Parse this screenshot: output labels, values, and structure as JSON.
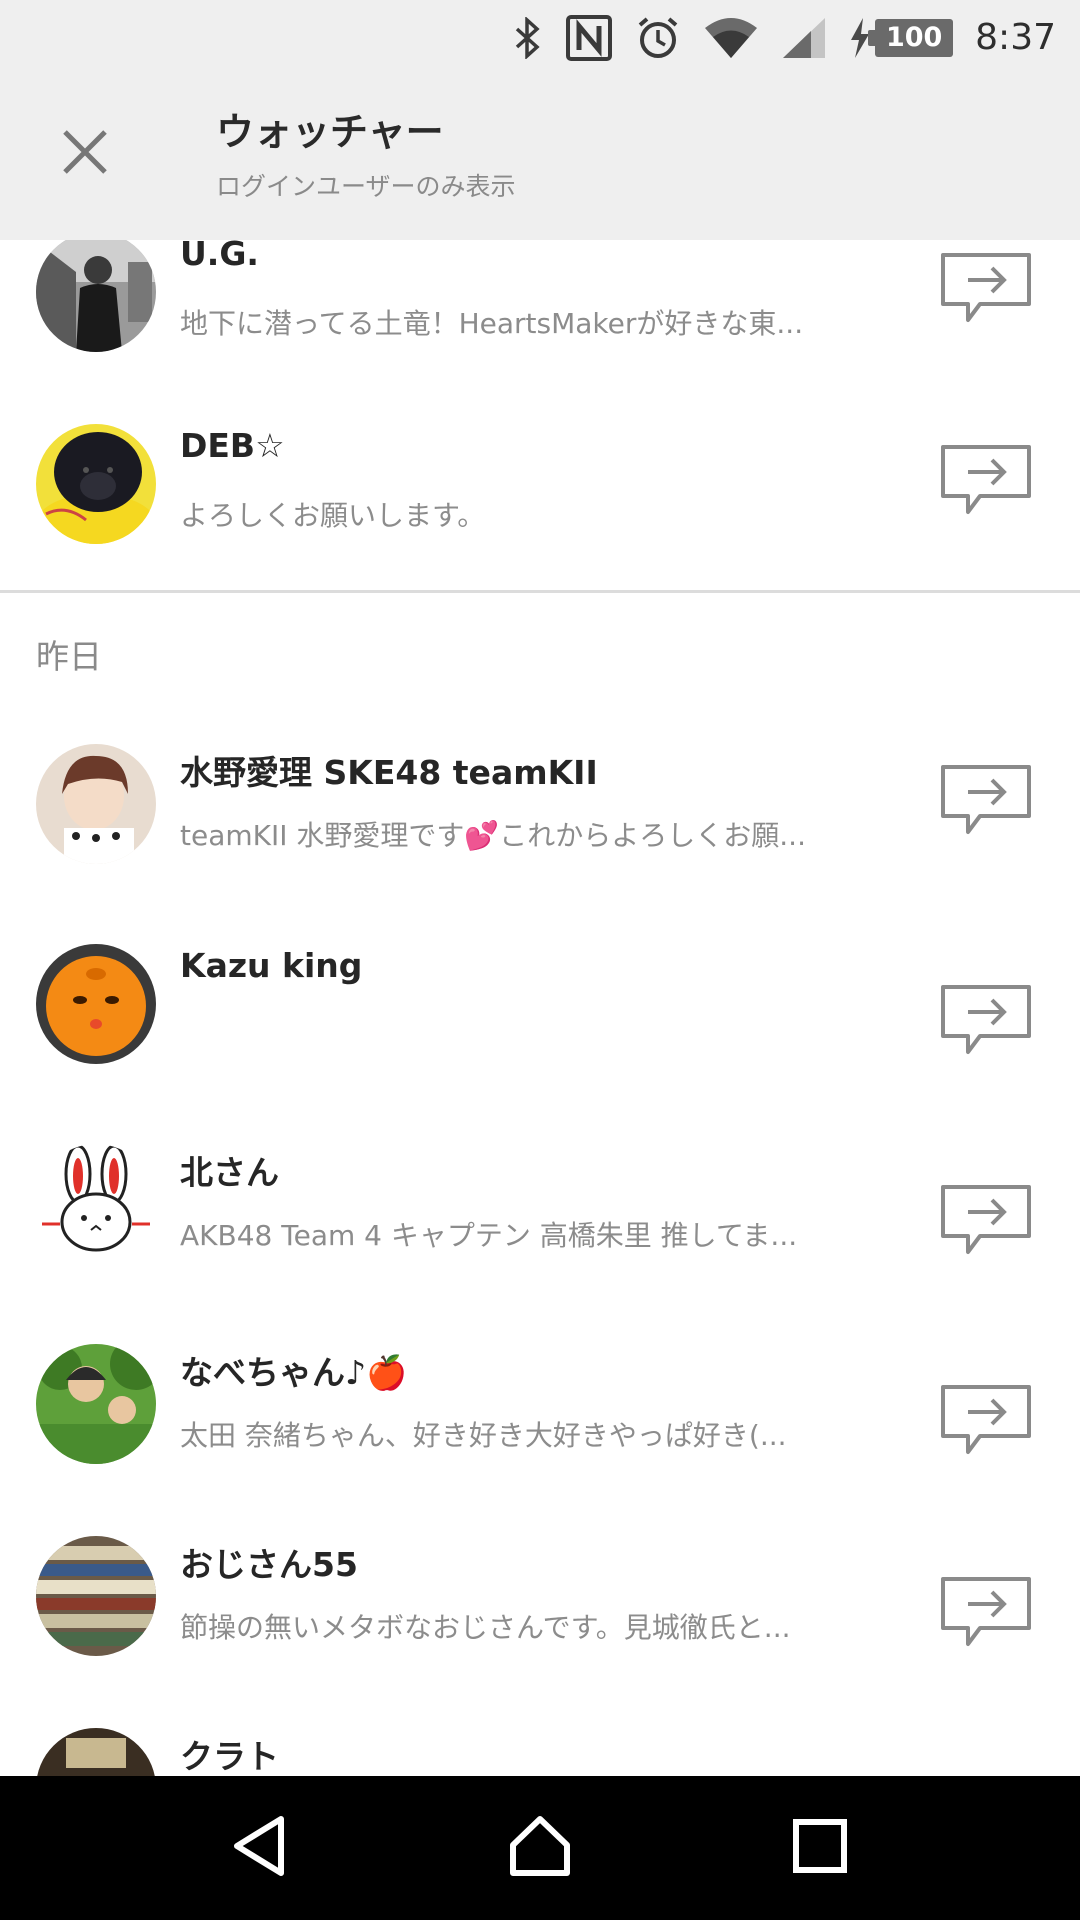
{
  "status_bar": {
    "battery_level": "100",
    "time": "8:37",
    "icons": [
      "bluetooth-icon",
      "nfc-icon",
      "alarm-icon",
      "wifi-icon",
      "signal-icon",
      "charging-icon"
    ]
  },
  "header": {
    "title": "ウォッチャー",
    "subtitle": "ログインユーザーのみ表示",
    "close_icon": "close-icon"
  },
  "section_yesterday": "昨日",
  "users_today": [
    {
      "name": "U.G.",
      "description": "地下に潜ってる土竜！HeartsMakerが好きな東..."
    },
    {
      "name": "DEB☆",
      "description": "よろしくお願いします。"
    }
  ],
  "users_yesterday": [
    {
      "name": "水野愛理 SKE48 teamKII",
      "description": "teamKII  水野愛理です💕これからよろしくお願..."
    },
    {
      "name": "Kazu king",
      "description": ""
    },
    {
      "name": "北さん",
      "description": "AKB48 Team 4 キャプテン 高橋朱里 推してま..."
    },
    {
      "name": "なべちゃん♪🍎",
      "description": "太田 奈緒ちゃん、好き好き大好きやっぱ好き(..."
    },
    {
      "name": "おじさん55",
      "description": "節操の無いメタボなおじさんです。見城徹氏と..."
    },
    {
      "name": "クラト",
      "description": ""
    }
  ],
  "row_action_icon": "message-arrow-icon",
  "nav": {
    "back_icon": "back-icon",
    "home_icon": "home-icon",
    "recents_icon": "recents-icon"
  },
  "colors": {
    "header_bg": "#efefef",
    "text_primary": "#262626",
    "text_secondary": "#8c8c8c",
    "nav_bg": "#000000"
  }
}
